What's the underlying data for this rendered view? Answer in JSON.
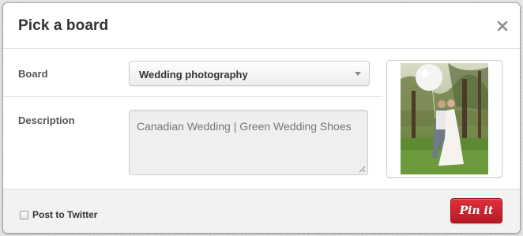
{
  "dialog": {
    "title": "Pick a board",
    "close_icon": "close-icon"
  },
  "form": {
    "board_label": "Board",
    "board_value": "Wedding photography",
    "description_label": "Description",
    "description_value": "Canadian Wedding | Green Wedding Shoes"
  },
  "preview": {
    "icon": "photo-thumbnail"
  },
  "footer": {
    "twitter_label": "Post to Twitter",
    "twitter_checked": false,
    "pin_button_label": "Pin it"
  },
  "colors": {
    "pin_button": "#cb2027",
    "title": "#333333"
  }
}
